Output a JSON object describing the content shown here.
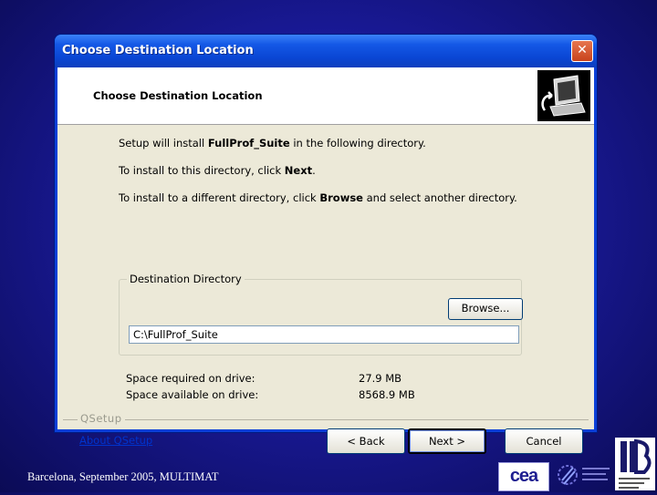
{
  "window": {
    "title": "Choose Destination Location",
    "close_glyph": "✕"
  },
  "header": {
    "title": "Choose Destination Location",
    "icon": "computer-install-icon"
  },
  "info": {
    "line1_pre": "Setup will install ",
    "line1_bold": "FullProf_Suite",
    "line1_post": " in the following directory.",
    "line2_pre": "To install to this directory, click ",
    "line2_bold": "Next",
    "line2_post": ".",
    "line3_pre": "To install to a different directory, click ",
    "line3_bold": "Browse",
    "line3_post": " and select another directory."
  },
  "destination": {
    "group_label": "Destination Directory",
    "browse_label": "Browse...",
    "path_value": "C:\\FullProf_Suite"
  },
  "space": {
    "required_label": "Space required on drive:",
    "required_value": "27.9 MB",
    "available_label": "Space available on drive:",
    "available_value": "8568.9 MB"
  },
  "footer": {
    "brand": "QSetup",
    "about_link": "About QSetup",
    "back_label": "< Back",
    "next_label": "Next >",
    "cancel_label": "Cancel"
  },
  "slide": {
    "footer_text": "Barcelona, September 2005, MULTIMAT",
    "logo_cea_text": "cea"
  },
  "colors": {
    "titlebar": "#0a46d4",
    "client_bg": "#ece9d8",
    "slide_bg": "#1a1a9a",
    "link": "#0033cc"
  }
}
